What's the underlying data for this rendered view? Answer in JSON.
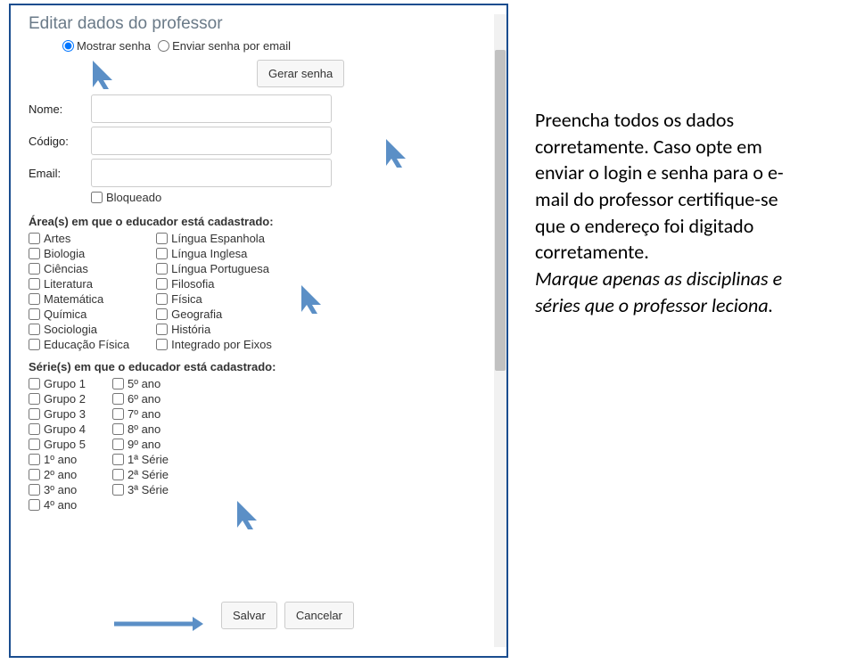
{
  "title": "Editar dados do professor",
  "passwordOptions": {
    "show": "Mostrar senha",
    "sendEmail": "Enviar senha por email"
  },
  "generatePassword": "Gerar senha",
  "fields": {
    "nome": "Nome:",
    "codigo": "Código:",
    "email": "Email:",
    "bloqueado": "Bloqueado"
  },
  "areasLabel": "Área(s) em que o educador está cadastrado:",
  "areas": {
    "col1": [
      "Artes",
      "Biologia",
      "Ciências",
      "Literatura",
      "Matemática",
      "Química",
      "Sociologia",
      "Educação Física"
    ],
    "col2": [
      "Língua Espanhola",
      "Língua Inglesa",
      "Língua Portuguesa",
      "Filosofia",
      "Física",
      "Geografia",
      "História",
      "Integrado por Eixos"
    ]
  },
  "seriesLabel": "Série(s) em que o educador está cadastrado:",
  "series": {
    "col1": [
      "Grupo 1",
      "Grupo 2",
      "Grupo 3",
      "Grupo 4",
      "Grupo 5",
      "1º ano",
      "2º ano",
      "3º ano",
      "4º ano"
    ],
    "col2": [
      "5º ano",
      "6º ano",
      "7º ano",
      "8º ano",
      "9º ano",
      "1ª Série",
      "2ª Série",
      "3ª Série"
    ]
  },
  "buttons": {
    "save": "Salvar",
    "cancel": "Cancelar"
  },
  "instructions": {
    "p1a": "Preencha todos os dados corretamente.",
    "p1b": " Caso opte em enviar o login e senha para o e-mail do professor certifique-se que o endereço foi digitado corretamente.",
    "p2": "Marque apenas as disciplinas e séries que o professor leciona."
  }
}
